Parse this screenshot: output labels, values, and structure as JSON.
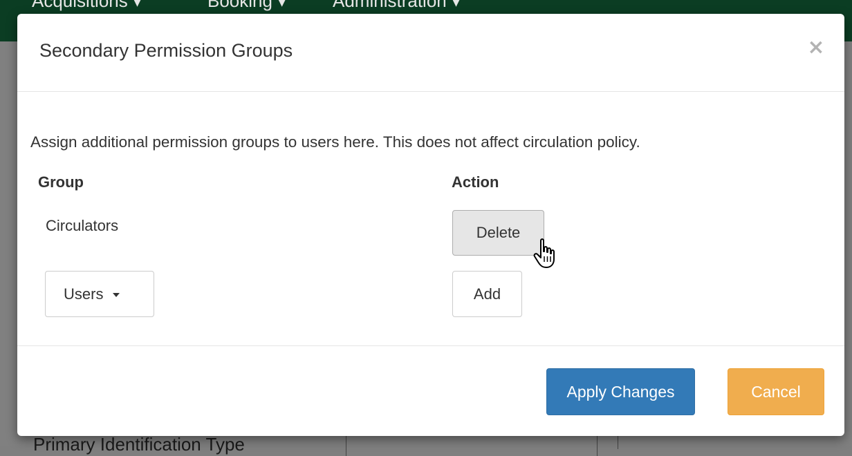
{
  "backdrop": {
    "nav_items": [
      "Acquisitions ▾",
      "Booking ▾",
      "Administration ▾"
    ],
    "field_label": "Primary Identification Type"
  },
  "dialog": {
    "title": "Secondary Permission Groups",
    "close_symbol": "×",
    "description": "Assign additional permission groups to users here. This does not affect circulation policy.",
    "columns": {
      "group": "Group",
      "action": "Action"
    },
    "rows": [
      {
        "group": "Circulators",
        "action_label": "Delete"
      }
    ],
    "new_row": {
      "selected_group": "Users",
      "add_label": "Add"
    },
    "footer": {
      "apply_label": "Apply Changes",
      "cancel_label": "Cancel"
    }
  },
  "colors": {
    "nav_bg": "#0b3d23",
    "primary": "#337ab7",
    "warning": "#f0ad4e"
  },
  "icons": {
    "close": "close-icon",
    "dropdown": "chevron-down-icon",
    "cursor": "hand-pointer-icon"
  }
}
